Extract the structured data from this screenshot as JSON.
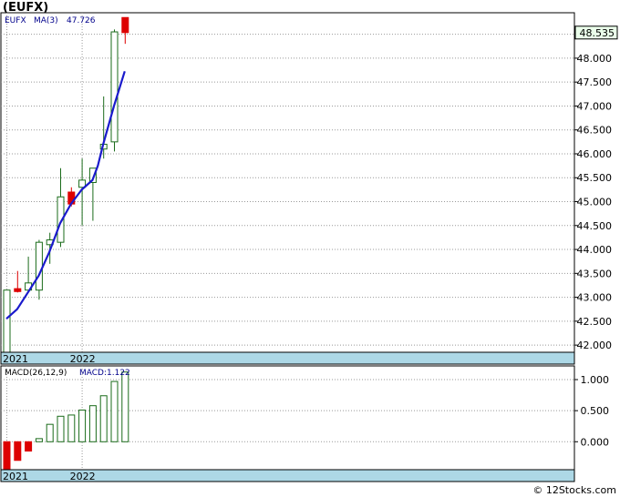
{
  "header": {
    "title": "(EUFX)"
  },
  "footer": {
    "credit": "© 12Stocks.com"
  },
  "colors": {
    "up": "#1a6b1a",
    "down": "#dd0000",
    "ma": "#1a1acc",
    "band": "#add8e6",
    "price_box": "#eaffea"
  },
  "chart_data": [
    {
      "type": "candlestick",
      "symbol": "EUFX",
      "legend": {
        "symbol": "EUFX",
        "ma_label": "MA(3)",
        "ma_value": "47.726"
      },
      "last_price_label": "48.535",
      "x_labels": [
        {
          "label": "2021",
          "index": 0
        },
        {
          "label": "2022",
          "index": 7
        }
      ],
      "y_ticks": [
        42.0,
        42.5,
        43.0,
        43.5,
        44.0,
        44.5,
        45.0,
        45.5,
        46.0,
        46.5,
        47.0,
        47.5,
        48.0,
        48.5
      ],
      "y_tick_labels": [
        "42.000",
        "42.500",
        "43.000",
        "43.500",
        "44.000",
        "44.500",
        "45.000",
        "45.500",
        "46.000",
        "46.500",
        "47.000",
        "47.500",
        "48.000",
        "48.500"
      ],
      "ylim": [
        41.85,
        48.95
      ],
      "grid": true,
      "candles": [
        {
          "open": 41.75,
          "high": 43.15,
          "low": 41.75,
          "close": 43.15
        },
        {
          "open": 43.18,
          "high": 43.55,
          "low": 43.1,
          "close": 43.12
        },
        {
          "open": 43.15,
          "high": 43.85,
          "low": 43.1,
          "close": 43.3
        },
        {
          "open": 43.15,
          "high": 44.2,
          "low": 42.95,
          "close": 44.15
        },
        {
          "open": 44.1,
          "high": 44.35,
          "low": 43.7,
          "close": 44.2
        },
        {
          "open": 44.15,
          "high": 45.7,
          "low": 44.05,
          "close": 45.1
        },
        {
          "open": 45.2,
          "high": 45.3,
          "low": 44.9,
          "close": 44.95
        },
        {
          "open": 45.3,
          "high": 45.9,
          "low": 44.5,
          "close": 45.45
        },
        {
          "open": 45.4,
          "high": 45.7,
          "low": 44.6,
          "close": 45.7
        },
        {
          "open": 46.1,
          "high": 47.2,
          "low": 45.9,
          "close": 46.2
        },
        {
          "open": 46.25,
          "high": 48.6,
          "low": 46.05,
          "close": 48.55
        },
        {
          "open": 48.85,
          "high": 48.85,
          "low": 48.3,
          "close": 48.535
        }
      ],
      "ma3": [
        {
          "index": 0,
          "value": 42.55
        },
        {
          "index": 1,
          "value": 42.75
        },
        {
          "index": 2,
          "value": 43.1
        },
        {
          "index": 3,
          "value": 43.45
        },
        {
          "index": 4,
          "value": 43.95
        },
        {
          "index": 5,
          "value": 44.55
        },
        {
          "index": 6,
          "value": 44.95
        },
        {
          "index": 7,
          "value": 45.25
        },
        {
          "index": 8,
          "value": 45.45
        },
        {
          "index": 8.5,
          "value": 45.75
        },
        {
          "index": 9,
          "value": 46.2
        },
        {
          "index": 10,
          "value": 47.0
        },
        {
          "index": 11,
          "value": 47.726
        }
      ]
    },
    {
      "type": "bar",
      "title": "MACD(26,12,9)",
      "legend": {
        "name": "MACD(26,12,9)",
        "value_label": "MACD:1.122"
      },
      "x_labels": [
        {
          "label": "2021",
          "index": 0
        },
        {
          "label": "2022",
          "index": 7
        }
      ],
      "y_ticks": [
        0.0,
        0.5,
        1.0
      ],
      "y_tick_labels": [
        "0.000",
        "0.500",
        "1.000"
      ],
      "ylim": [
        -0.45,
        1.22
      ],
      "grid": true,
      "values": [
        -0.45,
        -0.3,
        -0.15,
        0.05,
        0.28,
        0.41,
        0.43,
        0.51,
        0.58,
        0.74,
        0.97,
        1.122
      ]
    }
  ]
}
